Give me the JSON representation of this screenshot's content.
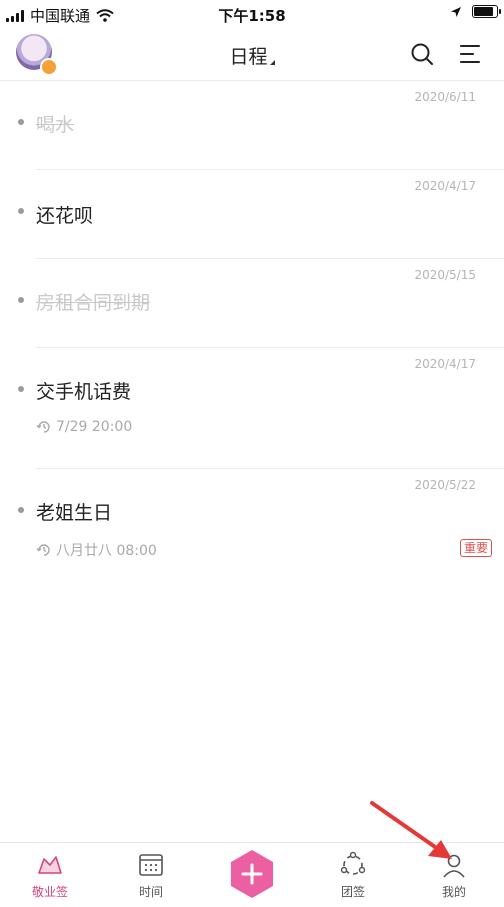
{
  "status_bar": {
    "carrier": "中国联通",
    "time": "下午1:58"
  },
  "header": {
    "title": "日程"
  },
  "items": [
    {
      "date": "2020/6/11",
      "title": "喝水",
      "done": true
    },
    {
      "date": "2020/4/17",
      "title": "还花呗",
      "done": false
    },
    {
      "date": "2020/5/15",
      "title": "房租合同到期",
      "done": true
    },
    {
      "date": "2020/4/17",
      "title": "交手机话费",
      "done": false,
      "repeat": "7/29 20:00"
    },
    {
      "date": "2020/5/22",
      "title": "老姐生日",
      "done": false,
      "repeat": "八月廿八 08:00",
      "tag": "重要"
    }
  ],
  "bottom_nav": {
    "items": [
      "敬业签",
      "时间",
      "团签",
      "我的"
    ],
    "active": "敬业签"
  },
  "colors": {
    "accent": "#d6457f",
    "add_button": "#ec5fa3",
    "important": "#d9534f"
  }
}
